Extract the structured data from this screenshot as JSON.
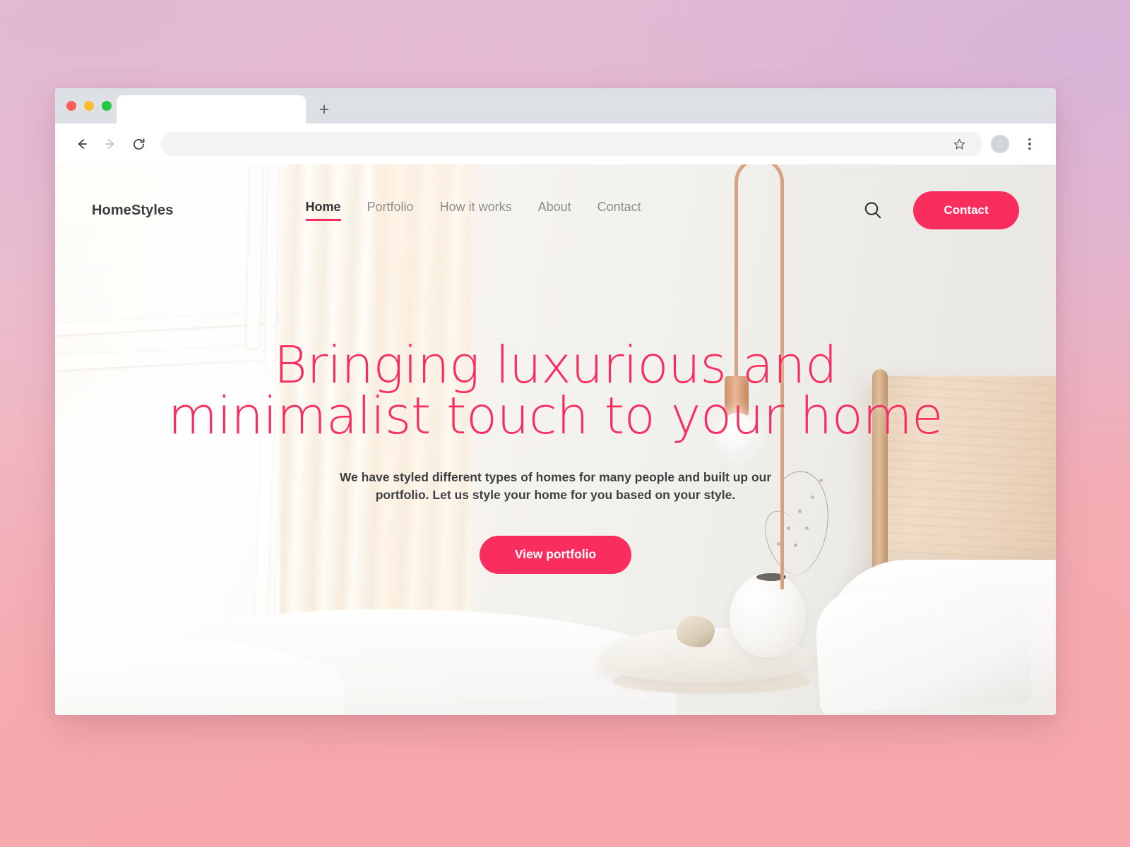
{
  "browser": {
    "traffic_lights": [
      "close",
      "minimize",
      "maximize"
    ],
    "tab_title": "",
    "new_tab_label": "+",
    "back_icon": "arrow-left-icon",
    "forward_icon": "arrow-right-icon",
    "reload_icon": "reload-icon",
    "address_value": "",
    "address_placeholder": "",
    "bookmark_icon": "star-icon",
    "profile_icon": "avatar-icon",
    "menu_icon": "three-dot-menu-icon"
  },
  "site": {
    "logo": "HomeStyles",
    "nav": [
      {
        "label": "Home",
        "active": true
      },
      {
        "label": "Portfolio",
        "active": false
      },
      {
        "label": "How it works",
        "active": false
      },
      {
        "label": "About",
        "active": false
      },
      {
        "label": "Contact",
        "active": false
      }
    ],
    "search_icon": "search-icon",
    "contact_button": "Contact"
  },
  "hero": {
    "headline_line1": "Bringing luxurious and",
    "headline_line2": "minimalist touch to your home",
    "subtitle_line1": "We have styled different types of homes for many people and built up our",
    "subtitle_line2": "portfolio. Let us style your home for you based on your style.",
    "cta_button": "View portfolio"
  },
  "colors": {
    "accent": "#f92e5e",
    "headline": "#f92e5e",
    "body_text": "#3f3f3f",
    "nav_inactive": "#8d8d8d",
    "nav_active": "#333333",
    "page_bg_top": "#e7c2d6",
    "page_bg_bottom": "#f6a8ae",
    "browser_chrome": "#dde1e6"
  }
}
